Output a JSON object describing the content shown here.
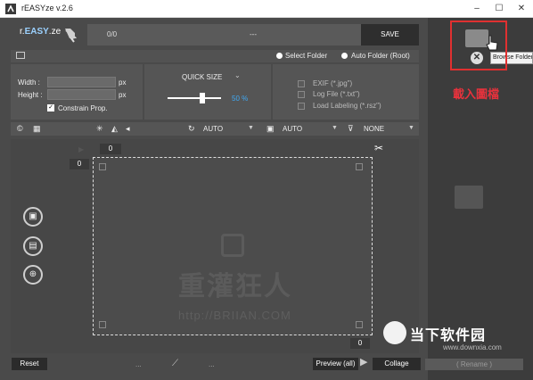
{
  "window": {
    "title": "rEASYze v.2.6",
    "minimize": "–",
    "maximize": "☐",
    "close": "✕"
  },
  "header": {
    "logo_prefix": "r.",
    "logo_bold": "EASY",
    "logo_suffix": ".ze",
    "counter": "0/0",
    "status": "---",
    "save_label": "SAVE"
  },
  "source": {
    "select_folder": "Select Folder",
    "auto_folder": "Auto Folder (Root)"
  },
  "size": {
    "width_label": "Width :",
    "height_label": "Height :",
    "unit": "px",
    "constrain_label": "Constrain Prop.",
    "constrain_checked": true
  },
  "quick_size": {
    "label": "QUICK SIZE",
    "value": "50 %",
    "level_percent": 50
  },
  "outputs": {
    "exif": "EXIF (*.jpg\")",
    "log": "Log File (*.txt\")",
    "labeling": "Load Labeling (*.rsz\")"
  },
  "toolbar": {
    "rotate_value": "AUTO",
    "print_value": "AUTO",
    "filter_value": "NONE"
  },
  "canvas": {
    "top_value": "0",
    "left_value": "0",
    "bottom_value": "0",
    "watermark": "重灌狂人",
    "watermark_url": "http://BRIIAN.COM"
  },
  "bottom": {
    "reset": "Reset",
    "dots": "...",
    "preview": "Preview (all)",
    "collage": "Collage"
  },
  "right": {
    "tooltip": "Browse Folder",
    "load_label": "載入圖檔",
    "rename": "( Rename )",
    "site_name": "当下软件园",
    "site_url": "www.downxia.com"
  },
  "colors": {
    "accent": "#3fa9f5",
    "highlight": "#e03030"
  },
  "icons": {
    "app": "app-icon",
    "copyright": "copyright-icon",
    "grid": "grid-icon",
    "brightness": "brightness-icon",
    "flip": "flip-icon",
    "perspective": "perspective-icon",
    "rotate": "rotate-icon",
    "printer": "printer-icon",
    "filter": "filter-icon",
    "scissors": "scissors-icon",
    "save": "save-icon",
    "document": "document-icon",
    "zoom": "zoom-icon",
    "folder": "folder-icon",
    "close": "close-icon",
    "ruler": "ruler-icon"
  }
}
